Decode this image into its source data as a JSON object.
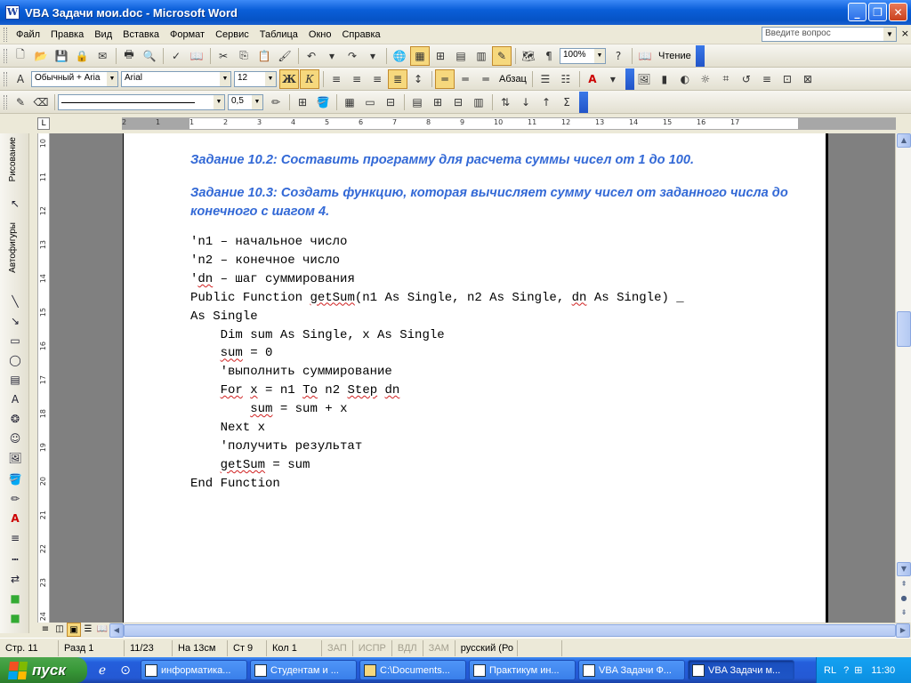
{
  "window": {
    "title": "VBA Задачи мои.doc - Microsoft Word",
    "icon_letter": "W",
    "minimize": "_",
    "maximize": "❐",
    "close": "✕"
  },
  "menu": {
    "items": [
      "Файл",
      "Правка",
      "Вид",
      "Вставка",
      "Формат",
      "Сервис",
      "Таблица",
      "Окно",
      "Справка"
    ],
    "ask_placeholder": "Введите вопрос",
    "close_doc": "×"
  },
  "standard_toolbar": {
    "zoom": "100%",
    "read_label": "Чтение"
  },
  "format_toolbar": {
    "style": "Обычный + Aria",
    "font": "Arial",
    "size": "12",
    "bold": "Ж",
    "italic": "К",
    "underline": "Ч",
    "paragraph_label": "Абзац",
    "sum_symbol": "Σ"
  },
  "drawing_toolbar": {
    "line_width": "0,5"
  },
  "sidebar": {
    "drawing_label": "Рисование",
    "autoshapes_label": "Автофигуры"
  },
  "document": {
    "task_10_2": "Задание 10.2: Составить  программу для расчета суммы чисел от 1 до 100.",
    "task_10_3": "Задание 10.3: Создать функцию, которая вычисляет  сумму чисел от заданного числа до конечного с шагом 4.",
    "code_lines": [
      "'n1 – начальное число",
      "'n2 – конечное число",
      "'dn – шаг суммирования",
      "Public Function getSum(n1 As Single, n2 As Single, dn As Single) _",
      "As Single",
      "    Dim sum As Single, x As Single",
      "    sum = 0",
      "    'выполнить суммирование",
      "    For x = n1 To n2 Step dn",
      "        sum = sum + x",
      "    Next x",
      "    'получить результат",
      "    getSum = sum",
      "End Function"
    ]
  },
  "ruler": {
    "h_numbers": [
      "2",
      "1",
      "1",
      "2",
      "3",
      "4",
      "5",
      "6",
      "7",
      "8",
      "9",
      "10",
      "11",
      "12",
      "13",
      "14",
      "15",
      "16",
      "17"
    ],
    "v_numbers": [
      "10",
      "11",
      "12",
      "13",
      "14",
      "15",
      "16",
      "17",
      "18",
      "19",
      "20",
      "21",
      "22",
      "23",
      "24"
    ]
  },
  "status": {
    "page": "Стр. 11",
    "section": "Разд 1",
    "pages": "11/23",
    "at": "На 13см",
    "line": "Ст 9",
    "col": "Кол 1",
    "rec": "ЗАП",
    "trk": "ИСПР",
    "ext": "ВДЛ",
    "ovr": "ЗАМ",
    "lang": "русский (Ро"
  },
  "taskbar": {
    "start": "пуск",
    "tasks": [
      "информатика...",
      "Студентам и ...",
      "C:\\Documents...",
      "Практикум ин...",
      "VBA Задачи Ф...",
      "VBA Задачи м..."
    ],
    "lang": "RL",
    "clock": "11:30"
  }
}
